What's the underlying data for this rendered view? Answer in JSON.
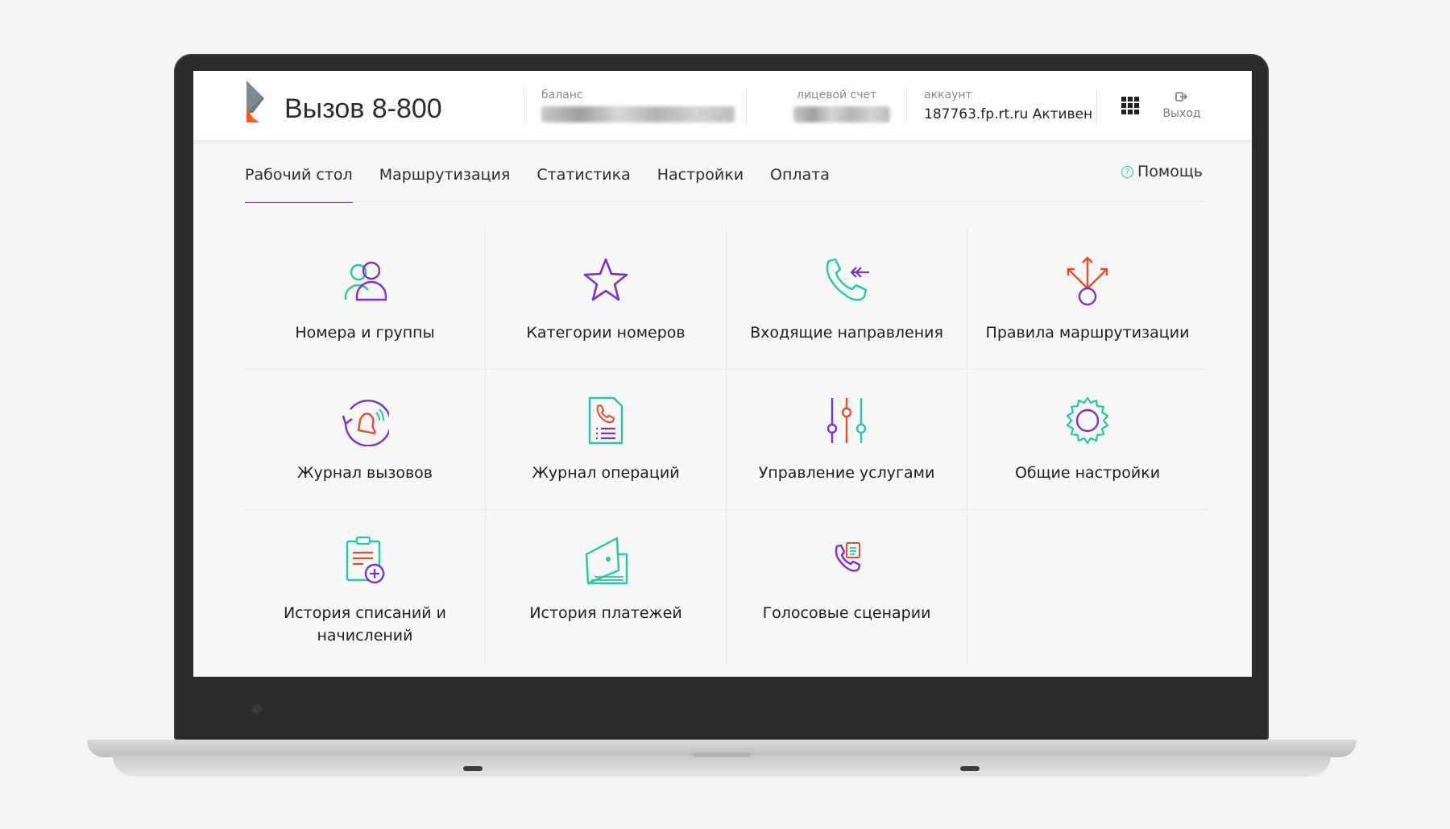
{
  "header": {
    "app_title": "Вызов 8-800",
    "balance_label": "баланс",
    "account_number_label": "лицевой счет",
    "account_label": "аккаунт",
    "account_value": "187763.fp.rt.ru Активен",
    "apps_icon": "grid-icon",
    "logout_label": "Выход",
    "logout_icon": "logout-icon"
  },
  "nav": {
    "items": [
      {
        "label": "Рабочий стол",
        "active": true
      },
      {
        "label": "Маршрутизация",
        "active": false
      },
      {
        "label": "Статистика",
        "active": false
      },
      {
        "label": "Настройки",
        "active": false
      },
      {
        "label": "Оплата",
        "active": false
      }
    ],
    "help_label": "Помощь"
  },
  "tiles": [
    {
      "label": "Номера и группы",
      "icon": "users-icon"
    },
    {
      "label": "Категории номеров",
      "icon": "star-icon"
    },
    {
      "label": "Входящие направления",
      "icon": "incoming-call-icon"
    },
    {
      "label": "Правила маршрутизации",
      "icon": "routing-icon"
    },
    {
      "label": "Журнал вызовов",
      "icon": "call-log-icon"
    },
    {
      "label": "Журнал операций",
      "icon": "operations-log-icon"
    },
    {
      "label": "Управление услугами",
      "icon": "sliders-icon"
    },
    {
      "label": "Общие настройки",
      "icon": "gear-icon"
    },
    {
      "label": "История списаний и начислений",
      "icon": "charges-history-icon"
    },
    {
      "label": "История платежей",
      "icon": "wallet-icon"
    },
    {
      "label": "Голосовые сценарии",
      "icon": "voice-scenario-icon"
    }
  ],
  "colors": {
    "accent_purple": "#7b2fd6",
    "accent_teal": "#28c7a0",
    "accent_red": "#ef4a2b",
    "logo_grey": "#7c8b8f",
    "logo_orange": "#ff5a1f"
  }
}
